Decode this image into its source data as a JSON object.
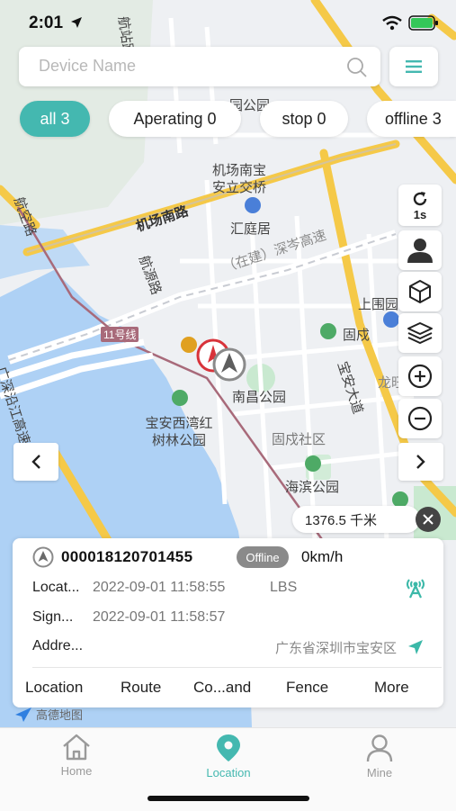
{
  "status_bar": {
    "time": "2:01"
  },
  "search": {
    "placeholder": "Device Name"
  },
  "filters": [
    {
      "label": "all 3",
      "active": true
    },
    {
      "label": "Aperating 0",
      "active": false
    },
    {
      "label": "stop 0",
      "active": false
    },
    {
      "label": "offline 3",
      "active": false
    }
  ],
  "map": {
    "labels": {
      "airport_south": "机场南宝",
      "anli_bridge": "安立交桥",
      "huitingju": "汇庭居",
      "airport_south_road": "机场南路",
      "shenen_expressway": "（在建）深岑高速",
      "hangyuan_road": "航源路",
      "hangkong_road": "航空路",
      "line11": "11号线",
      "shangwei": "上围园",
      "gushu": "固戍",
      "nanchang_park": "南昌公园",
      "baoan_park": "宝安西湾红树林公园",
      "gushu_community": "固戍社区",
      "baoan_avenue": "宝安大道",
      "longwang": "龙旺",
      "haibin_park": "海滨公园",
      "shenzhen_coast": "广深沿江高速",
      "hangzhan_road": "航站路",
      "park_top": "园公园"
    },
    "refresh_interval": "1s",
    "scale": "1376.5 千米",
    "logo": "高德地图"
  },
  "device": {
    "id": "000018120701455",
    "status": "Offline",
    "speed": "0km/h",
    "location_label": "Locat...",
    "location_time": "2022-09-01 11:58:55",
    "location_type": "LBS",
    "signal_label": "Sign...",
    "signal_time": "2022-09-01 11:58:57",
    "address_label": "Addre...",
    "address": "广东省深圳市宝安区"
  },
  "actions": [
    "Location",
    "Route",
    "Co...and",
    "Fence",
    "More"
  ],
  "tabs": [
    {
      "label": "Home",
      "active": false
    },
    {
      "label": "Location",
      "active": true
    },
    {
      "label": "Mine",
      "active": false
    }
  ],
  "colors": {
    "accent": "#44b8b0",
    "offline_badge": "#8a8a8a",
    "signal_icon": "#3bb8a8"
  }
}
